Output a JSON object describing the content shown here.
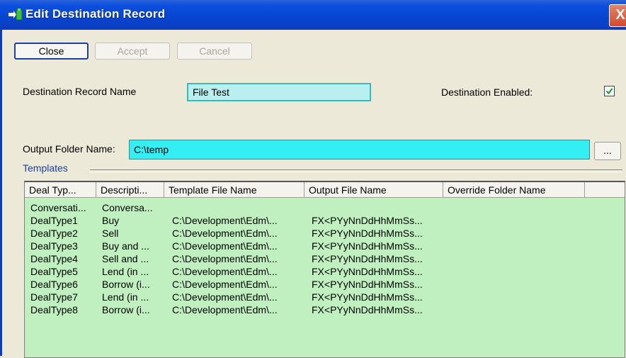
{
  "window": {
    "title": "Edit Destination Record",
    "close_glyph": "X",
    "title_bar_color": "#0a4fe0",
    "close_color": "#d24a2c"
  },
  "toolbar": {
    "close_label": "Close",
    "accept_label": "Accept",
    "cancel_label": "Cancel"
  },
  "form": {
    "record_name_label": "Destination Record Name",
    "record_name_value": "File Test",
    "enabled_label": "Destination Enabled:",
    "enabled_checked": true,
    "output_folder_label": "Output Folder Name:",
    "output_folder_value": "C:\\temp",
    "browse_label": "...",
    "input_highlight_color": "#33eef2"
  },
  "templates": {
    "group_label": "Templates",
    "grid_color": "#c0f0c0",
    "columns": [
      "Deal Typ...",
      "Descripti...",
      "Template File Name",
      "Output File Name",
      "Override Folder Name"
    ],
    "rows": [
      [
        "Conversati...",
        "Conversa...",
        "",
        "",
        ""
      ],
      [
        "DealType1",
        "Buy",
        "C:\\Development\\Edm\\...",
        "FX<PYyNnDdHhMmSs...",
        ""
      ],
      [
        "DealType2",
        "Sell",
        "C:\\Development\\Edm\\...",
        "FX<PYyNnDdHhMmSs...",
        ""
      ],
      [
        "DealType3",
        "Buy and ...",
        "C:\\Development\\Edm\\...",
        "FX<PYyNnDdHhMmSs...",
        ""
      ],
      [
        "DealType4",
        "Sell and ...",
        "C:\\Development\\Edm\\...",
        "FX<PYyNnDdHhMmSs...",
        ""
      ],
      [
        "DealType5",
        "Lend (in ...",
        "C:\\Development\\Edm\\...",
        "FX<PYyNnDdHhMmSs...",
        ""
      ],
      [
        "DealType6",
        "Borrow (i...",
        "C:\\Development\\Edm\\...",
        "FX<PYyNnDdHhMmSs...",
        ""
      ],
      [
        "DealType7",
        "Lend (in ...",
        "C:\\Development\\Edm\\...",
        "FX<PYyNnDdHhMmSs...",
        ""
      ],
      [
        "DealType8",
        "Borrow (i...",
        "C:\\Development\\Edm\\...",
        "FX<PYyNnDdHhMmSs...",
        ""
      ]
    ]
  }
}
